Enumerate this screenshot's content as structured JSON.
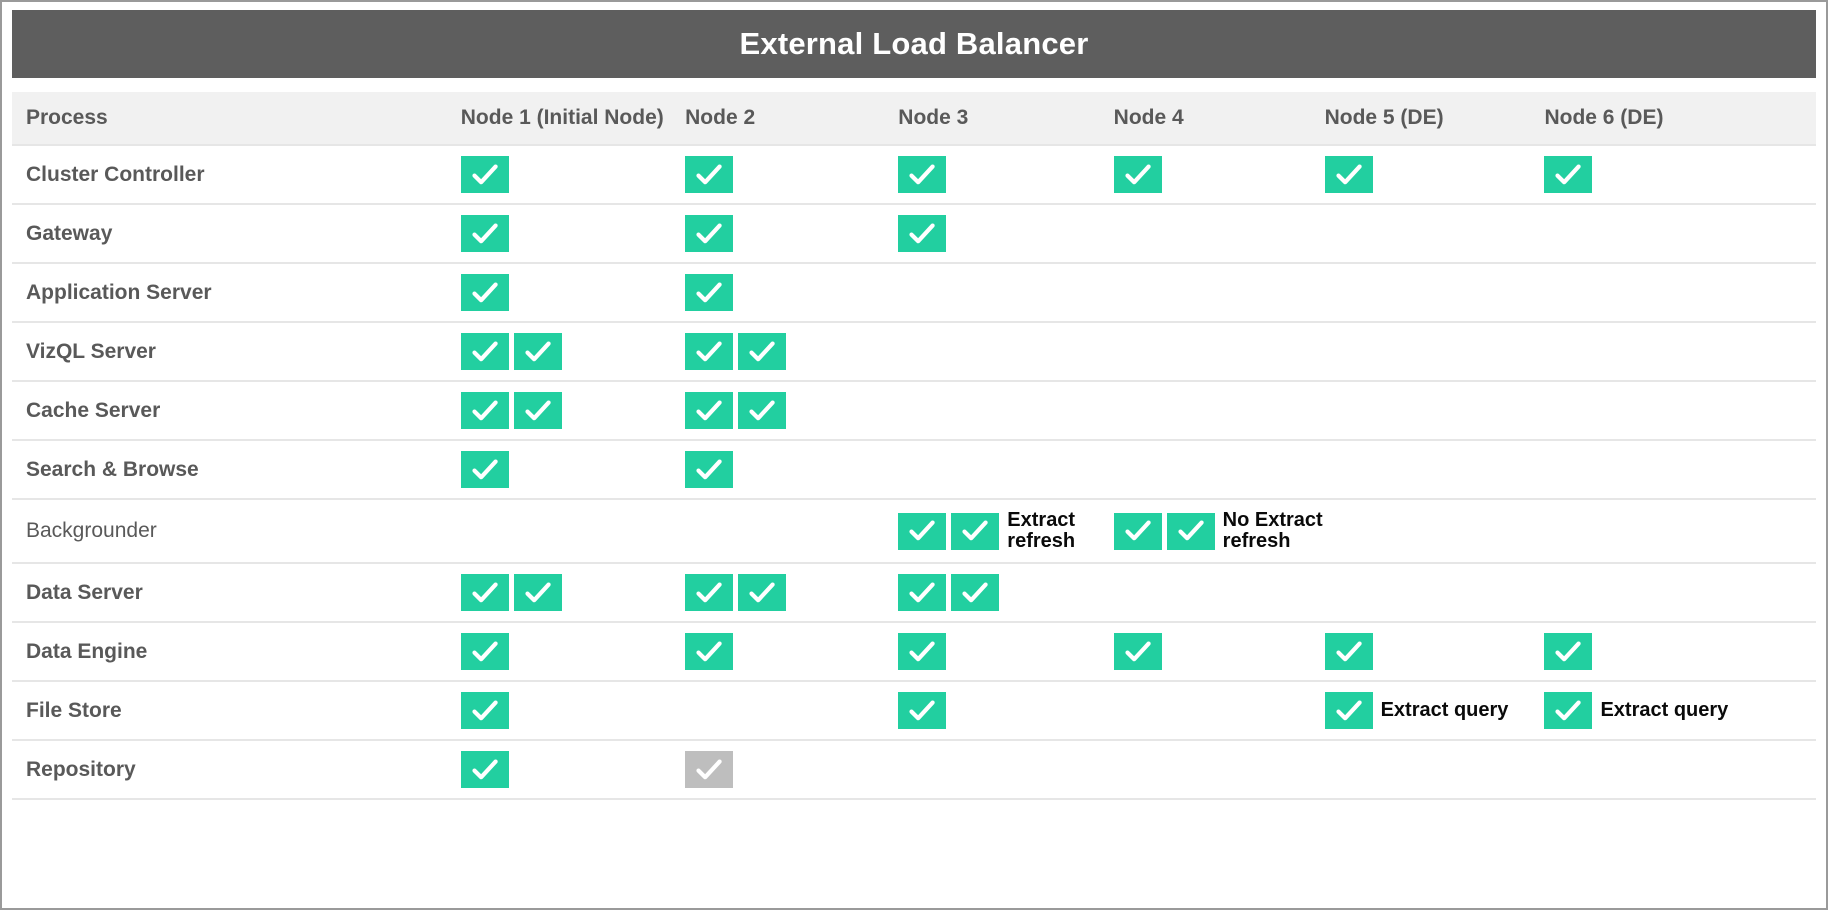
{
  "banner": {
    "title": "External Load Balancer",
    "background_color": "#5e5e5e",
    "text_color": "#ffffff"
  },
  "colors": {
    "check_active": "#22cfa0",
    "check_passive": "#bebebe",
    "header_row": "#f1f1f1",
    "label_text": "#595959",
    "row_divider": "#e6e6e6",
    "page_border": "#9a9a9a"
  },
  "table": {
    "columns": [
      {
        "key": "process",
        "label": "Process"
      },
      {
        "key": "node1",
        "label": "Node 1 (Initial Node)"
      },
      {
        "key": "node2",
        "label": "Node 2"
      },
      {
        "key": "node3",
        "label": "Node 3"
      },
      {
        "key": "node4",
        "label": "Node 4"
      },
      {
        "key": "node5",
        "label": "Node 5 (DE)"
      },
      {
        "key": "node6",
        "label": "Node 6 (DE)"
      }
    ],
    "rows": [
      {
        "process": "Cluster Controller",
        "cells": [
          {
            "checks": 1
          },
          {
            "checks": 1
          },
          {
            "checks": 1
          },
          {
            "checks": 1
          },
          {
            "checks": 1
          },
          {
            "checks": 1
          }
        ]
      },
      {
        "process": "Gateway",
        "cells": [
          {
            "checks": 1
          },
          {
            "checks": 1
          },
          {
            "checks": 1
          },
          {
            "checks": 0
          },
          {
            "checks": 0
          },
          {
            "checks": 0
          }
        ]
      },
      {
        "process": "Application Server",
        "cells": [
          {
            "checks": 1
          },
          {
            "checks": 1
          },
          {
            "checks": 0
          },
          {
            "checks": 0
          },
          {
            "checks": 0
          },
          {
            "checks": 0
          }
        ]
      },
      {
        "process": "VizQL Server",
        "cells": [
          {
            "checks": 2
          },
          {
            "checks": 2
          },
          {
            "checks": 0
          },
          {
            "checks": 0
          },
          {
            "checks": 0
          },
          {
            "checks": 0
          }
        ]
      },
      {
        "process": "Cache Server",
        "cells": [
          {
            "checks": 2
          },
          {
            "checks": 2
          },
          {
            "checks": 0
          },
          {
            "checks": 0
          },
          {
            "checks": 0
          },
          {
            "checks": 0
          }
        ]
      },
      {
        "process": "Search & Browse",
        "cells": [
          {
            "checks": 1
          },
          {
            "checks": 1
          },
          {
            "checks": 0
          },
          {
            "checks": 0
          },
          {
            "checks": 0
          },
          {
            "checks": 0
          }
        ]
      },
      {
        "process": "Backgrounder",
        "cells": [
          {
            "checks": 0
          },
          {
            "checks": 0
          },
          {
            "checks": 2,
            "note": "Extract\nrefresh"
          },
          {
            "checks": 2,
            "note": "No Extract\nrefresh"
          },
          {
            "checks": 0
          },
          {
            "checks": 0
          }
        ]
      },
      {
        "process": "Data Server",
        "cells": [
          {
            "checks": 2
          },
          {
            "checks": 2
          },
          {
            "checks": 2
          },
          {
            "checks": 0
          },
          {
            "checks": 0
          },
          {
            "checks": 0
          }
        ]
      },
      {
        "process": "Data Engine",
        "cells": [
          {
            "checks": 1
          },
          {
            "checks": 1
          },
          {
            "checks": 1
          },
          {
            "checks": 1
          },
          {
            "checks": 1
          },
          {
            "checks": 1
          }
        ]
      },
      {
        "process": "File Store",
        "cells": [
          {
            "checks": 1
          },
          {
            "checks": 0
          },
          {
            "checks": 1
          },
          {
            "checks": 0
          },
          {
            "checks": 1,
            "note": "Extract query"
          },
          {
            "checks": 1,
            "note": "Extract query"
          }
        ]
      },
      {
        "process": "Repository",
        "cells": [
          {
            "checks": 1
          },
          {
            "checks": 1,
            "state": "passive"
          },
          {
            "checks": 0
          },
          {
            "checks": 0
          },
          {
            "checks": 0
          },
          {
            "checks": 0
          }
        ]
      }
    ]
  }
}
